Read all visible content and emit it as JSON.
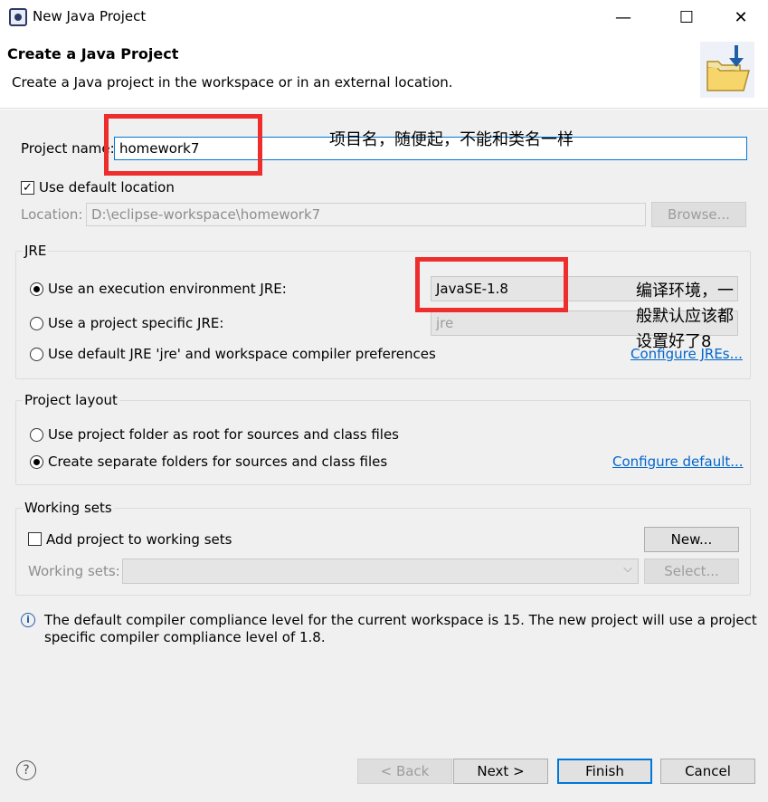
{
  "window": {
    "title": "New Java Project",
    "minimize_glyph": "—",
    "maximize_glyph": "☐",
    "close_glyph": "✕"
  },
  "header": {
    "title": "Create a Java Project",
    "description": "Create a Java project in the workspace or in an external location."
  },
  "project": {
    "name_label": "Project name:",
    "name_value": "homework7",
    "use_default_location_label": "Use default location",
    "use_default_location_checked": true,
    "location_label": "Location:",
    "location_value": "D:\\eclipse-workspace\\homework7",
    "browse_label": "Browse..."
  },
  "jre": {
    "group_title": "JRE",
    "option_execution_env": "Use an execution environment JRE:",
    "execution_env_value": "JavaSE-1.8",
    "option_project_specific": "Use a project specific JRE:",
    "project_specific_value": "jre",
    "option_default": "Use default JRE 'jre' and workspace compiler preferences",
    "configure_link": "Configure JREs...",
    "selected": "execution_env"
  },
  "layout": {
    "group_title": "Project layout",
    "option_root": "Use project folder as root for sources and class files",
    "option_separate": "Create separate folders for sources and class files",
    "configure_link": "Configure default...",
    "selected": "separate"
  },
  "working_sets": {
    "group_title": "Working sets",
    "add_label": "Add project to working sets",
    "add_checked": false,
    "new_button": "New...",
    "sets_label": "Working sets:",
    "select_button": "Select..."
  },
  "info": {
    "icon": "info-icon",
    "line1": "The default compiler compliance level for the current workspace is 15. The new project will use a project",
    "line2": "specific compiler compliance level of 1.8."
  },
  "footer": {
    "help_glyph": "?",
    "back_button": "< Back",
    "next_button": "Next >",
    "finish_button": "Finish",
    "cancel_button": "Cancel"
  },
  "annotations": {
    "project_name_note": "项目名，随便起，不能和类名一样",
    "jre_note_line1": "编译环境，一",
    "jre_note_line2": "般默认应该都",
    "jre_note_line3": "设置好了8"
  },
  "colors": {
    "accent": "#0078d7",
    "link": "#0066cc",
    "annotation_box": "#ee2d2d",
    "dialog_bg": "#f0f0f0"
  }
}
